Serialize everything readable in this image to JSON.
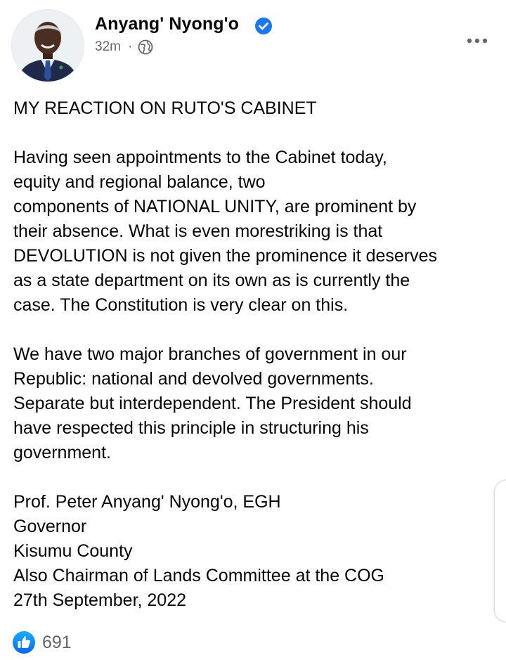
{
  "post": {
    "author": "Anyang' Nyong'o",
    "verified": true,
    "time": "32m",
    "separator": "·",
    "audience_icon": "globe-icon",
    "more_icon": "more-options-icon",
    "title": "MY REACTION ON RUTO'S CABINET",
    "paragraph1": [
      "Having seen appointments to the Cabinet today,",
      "equity and regional balance, two",
      "components of NATIONAL UNITY, are prominent by",
      "their absence. What is even morestriking is that",
      "DEVOLUTION is not given the prominence it deserves",
      "as a state department on its own as is currently the",
      "case. The Constitution is very clear on this."
    ],
    "paragraph2": [
      "We have two major branches of government in our",
      "Republic: national and devolved governments.",
      "Separate but interdependent. The President should",
      "have respected this principle in structuring his",
      "government."
    ],
    "signature": [
      "Prof. Peter Anyang' Nyong'o, EGH",
      "Governor",
      "Kisumu County",
      "Also Chairman of Lands Committee at the COG",
      "27th September, 2022"
    ]
  },
  "reactions": {
    "icon": "like-icon",
    "count": "691"
  },
  "colors": {
    "text": "#050505",
    "secondary": "#65676b",
    "accent": "#1877f2"
  }
}
